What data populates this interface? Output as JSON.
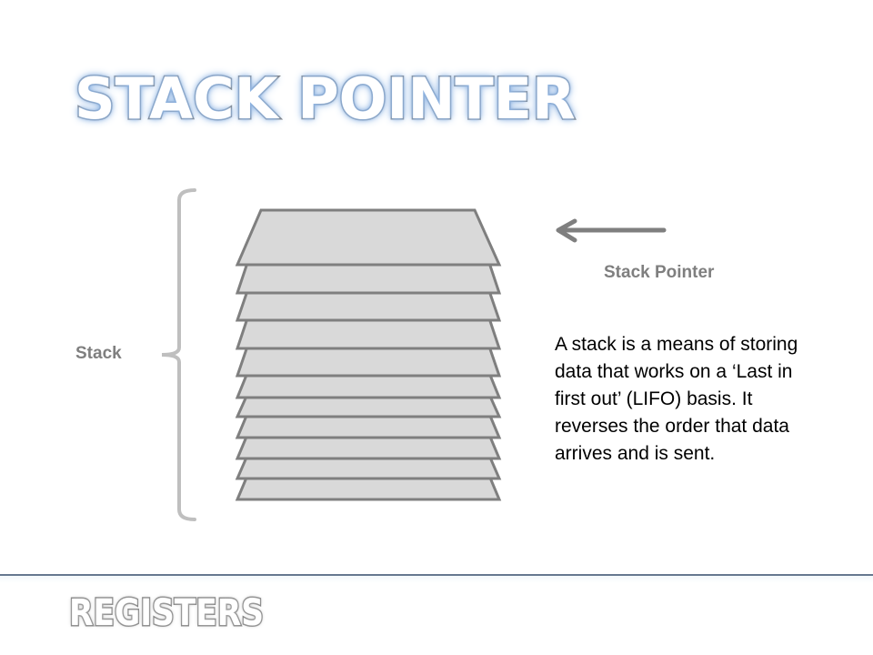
{
  "slide": {
    "title": "STACK POINTER",
    "footer_title": "REGISTERS"
  },
  "diagram": {
    "stack_label": "Stack",
    "pointer_label": "Stack Pointer",
    "layer_count": 11,
    "pointer_direction": "left",
    "colors": {
      "layer_fill": "#d9d9d9",
      "layer_stroke": "#7f7f7f",
      "brace": "#bfbfbf",
      "arrow": "#7f7f7f",
      "title_glow": "#8eb4e3",
      "divider": "#66788f"
    }
  },
  "description": "A stack is a means of storing data that works on a ‘Last in first out’ (LIFO) basis. It reverses the order that data arrives and is sent."
}
